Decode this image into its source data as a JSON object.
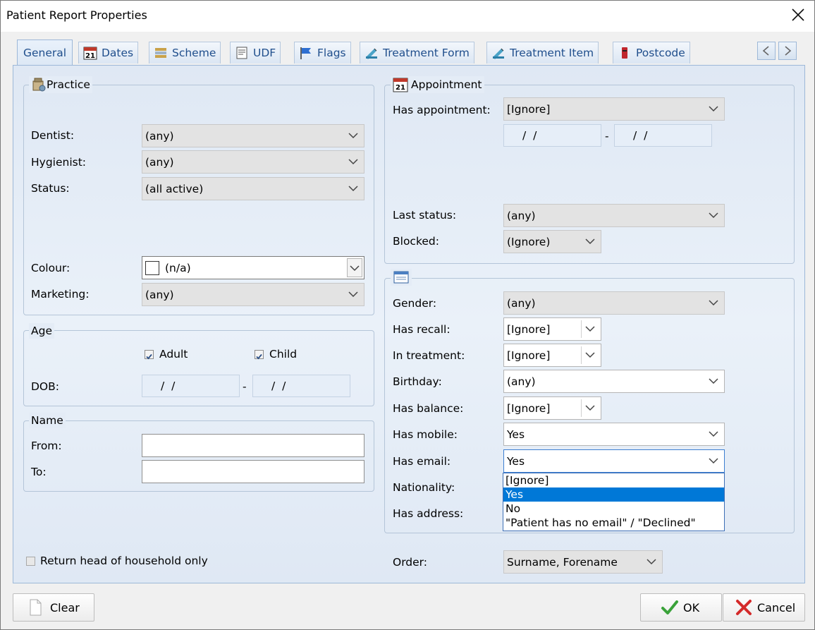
{
  "window": {
    "title": "Patient Report Properties"
  },
  "tabs": [
    {
      "label": "General",
      "icon": "none"
    },
    {
      "label": "Dates",
      "icon": "calendar-icon"
    },
    {
      "label": "Scheme",
      "icon": "scheme-icon"
    },
    {
      "label": "UDF",
      "icon": "udf-icon"
    },
    {
      "label": "Flags",
      "icon": "flag-icon"
    },
    {
      "label": "Treatment Form",
      "icon": "treatment-icon"
    },
    {
      "label": "Treatment Item",
      "icon": "treatment-icon"
    },
    {
      "label": "Postcode",
      "icon": "postbox-icon"
    }
  ],
  "practice": {
    "title": "Practice",
    "dentist_label": "Dentist:",
    "dentist_value": "(any)",
    "hygienist_label": "Hygienist:",
    "hygienist_value": "(any)",
    "status_label": "Status:",
    "status_value": "(all active)",
    "colour_label": "Colour:",
    "colour_value": "(n/a)",
    "marketing_label": "Marketing:",
    "marketing_value": "(any)"
  },
  "age": {
    "title": "Age",
    "adult_label": "Adult",
    "adult_checked": true,
    "child_label": "Child",
    "child_checked": true,
    "dob_label": "DOB:",
    "dob_from": "/  /",
    "dob_to": "/  /",
    "separator": "-"
  },
  "name": {
    "title": "Name",
    "from_label": "From:",
    "to_label": "To:"
  },
  "head_of_household": {
    "label": "Return head of household only",
    "checked": false
  },
  "appointment": {
    "title": "Appointment",
    "has_label": "Has appointment:",
    "has_value": "[Ignore]",
    "date_from": "/  /",
    "date_to": "/  /",
    "separator": "-",
    "last_status_label": "Last status:",
    "last_status_value": "(any)",
    "blocked_label": "Blocked:",
    "blocked_value": "(Ignore)"
  },
  "patient": {
    "gender_label": "Gender:",
    "gender_value": "(any)",
    "recall_label": "Has recall:",
    "recall_value": "[Ignore]",
    "treatment_label": "In treatment:",
    "treatment_value": "[Ignore]",
    "birthday_label": "Birthday:",
    "birthday_value": "(any)",
    "balance_label": "Has balance:",
    "balance_value": "[Ignore]",
    "mobile_label": "Has mobile:",
    "mobile_value": "Yes",
    "email_label": "Has email:",
    "email_value": "Yes",
    "nationality_label": "Nationality:",
    "address_label": "Has address:"
  },
  "email_dropdown": {
    "options": [
      "[Ignore]",
      "Yes",
      "No",
      "\"Patient has no email\" / \"Declined\""
    ],
    "selected_index": 1
  },
  "order": {
    "label": "Order:",
    "value": "Surname, Forename"
  },
  "buttons": {
    "clear": "Clear",
    "ok": "OK",
    "cancel": "Cancel"
  },
  "colors": {
    "accent": "#0078d7",
    "tab_text": "#1f4e8c",
    "ok_green": "#3aa23a",
    "cancel_red": "#d42a2a"
  }
}
